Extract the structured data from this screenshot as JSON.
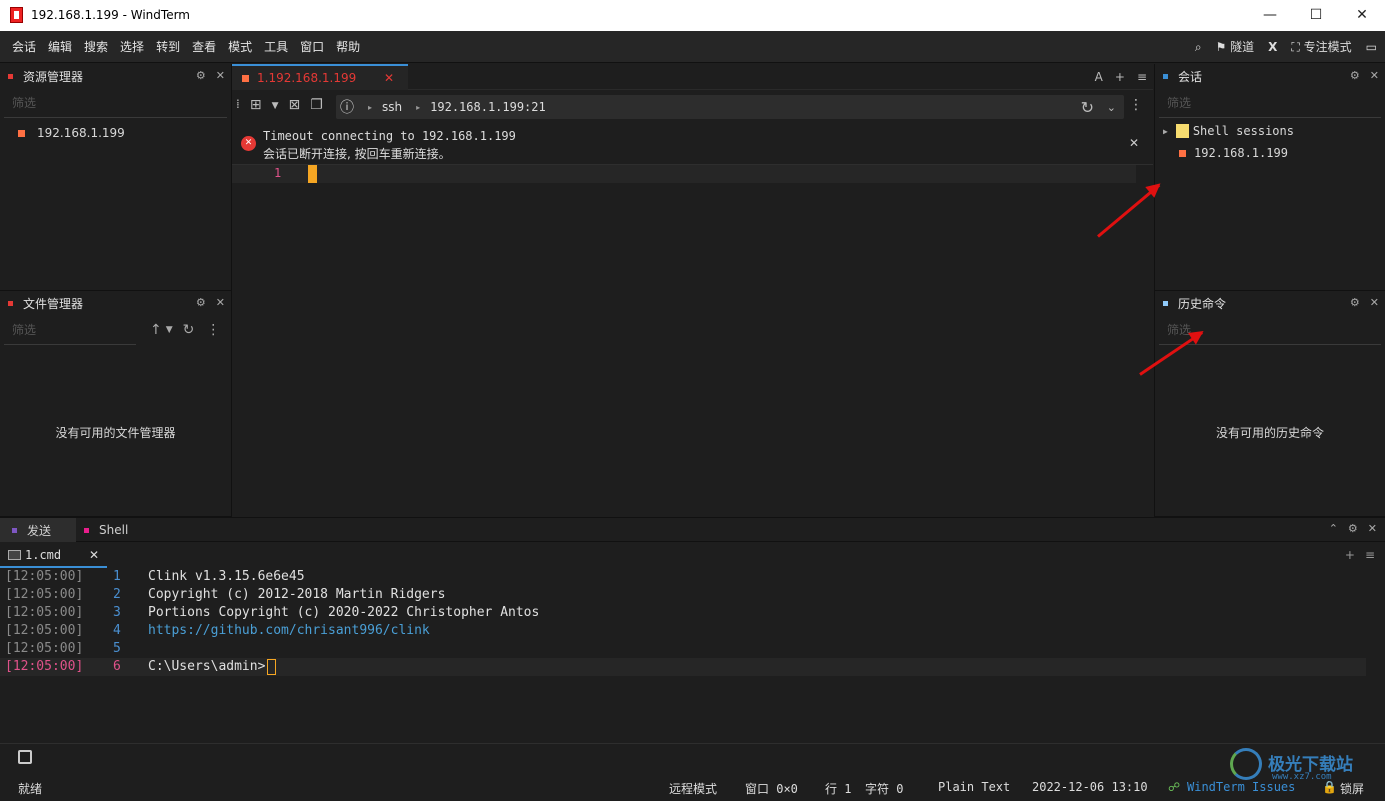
{
  "window": {
    "title": "192.168.1.199 - WindTerm",
    "min": "—",
    "max": "☐",
    "close": "✕"
  },
  "menu": [
    "会话",
    "编辑",
    "搜索",
    "选择",
    "转到",
    "查看",
    "模式",
    "工具",
    "窗口",
    "帮助"
  ],
  "menu_right": {
    "tunnel": "隧道",
    "focus": "专注模式",
    "x": "X"
  },
  "explorer": {
    "title": "资源管理器",
    "filter": "筛选",
    "host": "192.168.1.199"
  },
  "filemgr": {
    "title": "文件管理器",
    "filter": "筛选",
    "empty": "没有可用的文件管理器"
  },
  "tab": {
    "label": "1.192.168.1.199",
    "font": "A"
  },
  "urlbar": {
    "protocol": "ssh",
    "address": "192.168.1.199:21"
  },
  "notification": {
    "line1": "Timeout connecting to 192.168.1.199",
    "line2": "会话已断开连接, 按回车重新连接。"
  },
  "editor": {
    "line_no": "1"
  },
  "sessions": {
    "title": "会话",
    "filter": "筛选",
    "folder": "Shell sessions",
    "host": "192.168.1.199"
  },
  "history": {
    "title": "历史命令",
    "filter": "筛选",
    "empty": "没有可用的历史命令"
  },
  "bottom_tabs": {
    "send": "发送",
    "shell": "Shell",
    "cmd": "1.cmd"
  },
  "terminal": [
    {
      "time": "[12:05:00]",
      "n": "1",
      "text": "Clink v1.3.15.6e6e45"
    },
    {
      "time": "[12:05:00]",
      "n": "2",
      "text": "Copyright (c) 2012-2018 Martin Ridgers"
    },
    {
      "time": "[12:05:00]",
      "n": "3",
      "text": "Portions Copyright (c) 2020-2022 Christopher Antos"
    },
    {
      "time": "[12:05:00]",
      "n": "4",
      "text": "https://github.com/chrisant996/clink"
    },
    {
      "time": "[12:05:00]",
      "n": "5",
      "text": ""
    },
    {
      "time": "[12:05:00]",
      "n": "6",
      "text": "C:\\Users\\admin>"
    }
  ],
  "status": {
    "ready": "就绪",
    "mode": "远程模式",
    "window": "窗口 0×0",
    "row": "行 1",
    "col": "字符 0",
    "syntax": "Plain Text",
    "datetime": "2022-12-06 13:10",
    "issues": "WindTerm Issues",
    "lock": "锁屏"
  },
  "watermark": {
    "cn": "极光下载站",
    "url": "www.xz7.com"
  },
  "colors": {
    "accent": "#3a8fd6",
    "error": "#e53935",
    "orange": "#ff7043",
    "arrow": "#e01010"
  }
}
